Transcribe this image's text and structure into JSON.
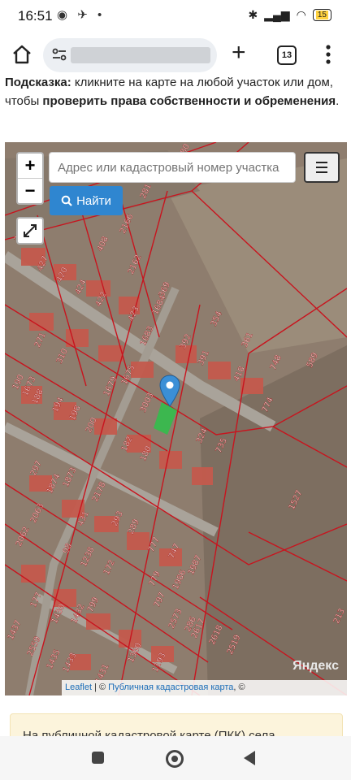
{
  "status_bar": {
    "time": "16:51",
    "battery": "15"
  },
  "browser": {
    "tabs_count": "13"
  },
  "hint": {
    "prefix": "Подсказка:",
    "cut_text": " кликните на карте на любой участок или дом, чтобы ",
    "bold_text": "проверить права собственности и обременения",
    "suffix": "."
  },
  "map": {
    "search_placeholder": "Адрес или кадастровый номер участка",
    "find_label": "Найти",
    "zoom_in": "+",
    "zoom_out": "−",
    "yandex": "Яндекс",
    "attribution_leaflet": "Leaflet",
    "attribution_sep": " | © ",
    "attribution_pkk": "Публичная кадастровая карта",
    "attribution_tail": ", ©",
    "parcel_labels": [
      "280",
      "281",
      "368",
      "408",
      "2166",
      "2162",
      "369",
      "427",
      "420",
      "424",
      "422",
      "423",
      "1684",
      "1683",
      "354",
      "392",
      "391",
      "361",
      "748",
      "589",
      "418",
      "310",
      "271",
      "1679",
      "1675",
      "1673",
      "3003",
      "774",
      "190",
      "188",
      "194",
      "198",
      "200",
      "182",
      "180",
      "324",
      "735",
      "297",
      "1874",
      "1873",
      "1527",
      "2178",
      "431",
      "293",
      "289",
      "2063",
      "2062",
      "98",
      "1238",
      "172",
      "779",
      "777",
      "747",
      "1987",
      "1986",
      "797",
      "177",
      "1430",
      "1432",
      "799",
      "286",
      "2573",
      "2617",
      "2618",
      "2519",
      "1437",
      "2559",
      "1435",
      "1433",
      "1360",
      "1193",
      "213",
      "1431"
    ],
    "marker_color": "#3b8fd6"
  },
  "info_box": {
    "text": "На публичной кадастровой карте (ПКК) села"
  }
}
